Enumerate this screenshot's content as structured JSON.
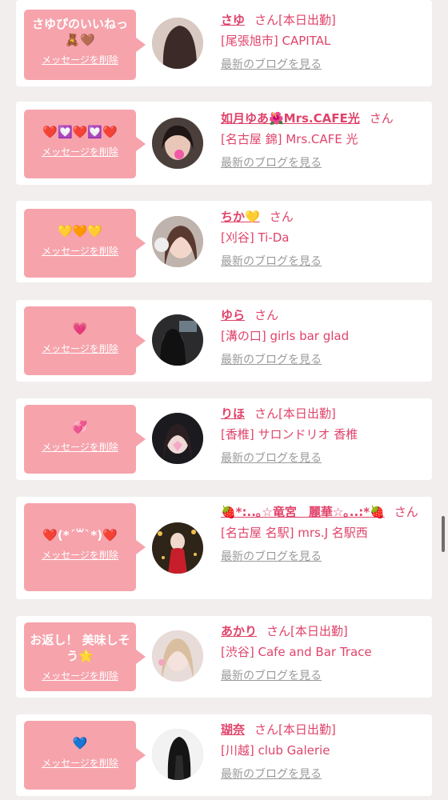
{
  "delete_label": "メッセージを削除",
  "blog_label": "最新のブログを見る",
  "colors": {
    "accent": "#e0436a",
    "bubble": "#f6a3ac",
    "muted": "#9a9a9a"
  },
  "entries": [
    {
      "message": "さゆぴのいいねっ🧸🤎",
      "name": "さゆ",
      "san": "さん",
      "status": "[本日出勤]",
      "shop": "[尾張旭市] CAPITAL"
    },
    {
      "message": "❤️💟❤️💟❤️",
      "name": "如月ゆあ🌺Mrs.CAFE光",
      "san": "さん",
      "status": "",
      "shop": "[名古屋 錦] Mrs.CAFE 光"
    },
    {
      "message": "💛🧡💛",
      "name": "ちか💛",
      "san": "さん",
      "status": "",
      "shop": "[刈谷] Ti-Da"
    },
    {
      "message": "💗",
      "name": "ゆら",
      "san": "さん",
      "status": "",
      "shop": "[溝の口] girls bar glad"
    },
    {
      "message": "💞",
      "name": "りほ",
      "san": "さん",
      "status": "[本日出勤]",
      "shop": "[香椎] サロンドリオ 香椎"
    },
    {
      "message": "❤️(*´꒳`*)❤️",
      "name": "🍓*:..｡☆竜宮　麗華☆｡..:*🍓",
      "san": "さん",
      "status": "",
      "shop": "[名古屋 名駅] mrs.J 名駅西"
    },
    {
      "message": "お返し！ 美味しそう🌟",
      "name": "あかり",
      "san": "さん",
      "status": "[本日出勤]",
      "shop": "[渋谷] Cafe and Bar Trace"
    },
    {
      "message": "💙",
      "name": "瑚奈",
      "san": "さん",
      "status": "[本日出勤]",
      "shop": "[川越] club Galerie"
    }
  ]
}
